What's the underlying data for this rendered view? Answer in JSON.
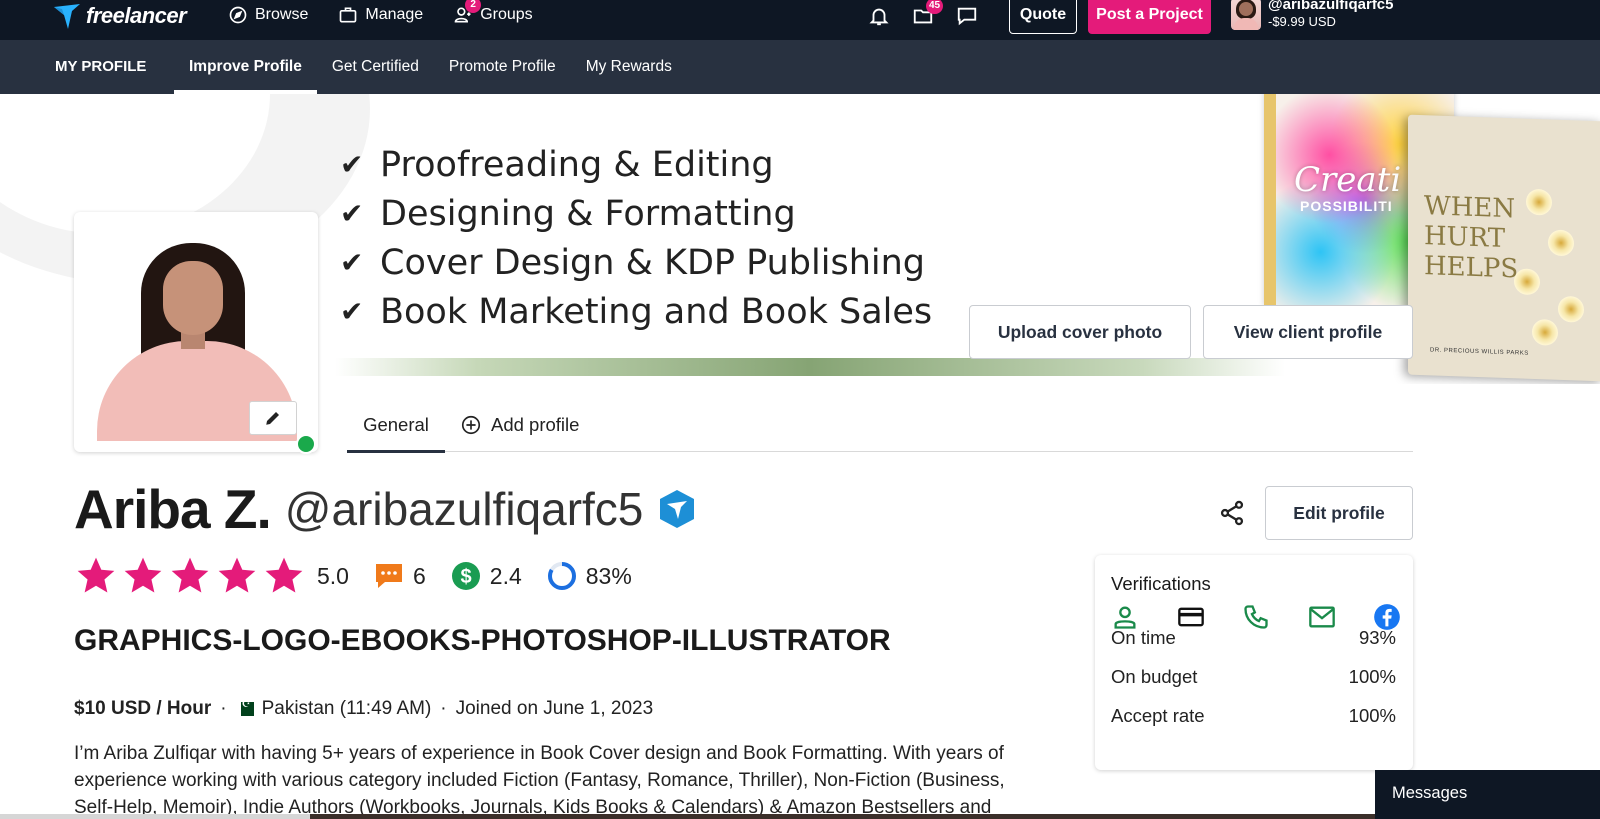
{
  "topbar": {
    "logo_text": "freelancer",
    "nav": [
      {
        "label": "Browse",
        "icon": "compass-icon"
      },
      {
        "label": "Manage",
        "icon": "briefcase-icon"
      },
      {
        "label": "Groups",
        "icon": "groups-icon",
        "badge": "2"
      }
    ],
    "projects_badge": "45",
    "quote_label": "Quote",
    "post_project_label": "Post a Project",
    "user_handle": "@aribazulfiqarfc5",
    "user_balance": "-$9.99 USD",
    "accent_color": "#e41b7a",
    "bg_color": "#0e1724"
  },
  "subnav": {
    "title": "MY PROFILE",
    "tabs": [
      "Improve Profile",
      "Get Certified",
      "Promote Profile",
      "My Rewards"
    ],
    "active_tab": "Improve Profile"
  },
  "cover": {
    "services": [
      "Proofreading & Editing",
      "Designing & Formatting",
      "Cover Design & KDP Publishing",
      "Book Marketing and Book Sales"
    ],
    "book1_title": "Creati",
    "book1_sub": "POSSIBILITI",
    "book2_title_lines": [
      "WHEN",
      "HURT",
      "HELPS"
    ],
    "book2_footer": "DR. PRECIOUS WILLIS PARKS",
    "upload_cover_label": "Upload cover photo",
    "view_client_label": "View client profile"
  },
  "profile_tabs": {
    "general": "General",
    "add_profile": "Add profile"
  },
  "profile": {
    "name": "Ariba Z.",
    "handle": "@aribazulfiqarfc5",
    "edit_label": "Edit profile",
    "rating": "5.0",
    "reviews": "6",
    "earnings_score": "2.4",
    "completion": "83%",
    "tagline": "GRAPHICS-LOGO-EBOOKS-PHOTOSHOP-ILLUSTRATOR",
    "rate": "$10 USD / Hour",
    "location": "Pakistan (11:49 AM)",
    "joined": "Joined on June 1, 2023",
    "bio": "I’m Ariba Zulfiqar with having 5+ years of experience in Book Cover design and Book Formatting. With years of experience working with various category included Fiction (Fantasy, Romance, Thriller), Non-Fiction (Business, Self-Help, Memoir), Indie Authors (Workbooks, Journals, Kids Books & Calendars) & Amazon Bestsellers and",
    "star_color": "#e41b7a",
    "online_color": "#1aa94b"
  },
  "verifications": {
    "title": "Verifications",
    "icons": [
      "user-icon",
      "card-icon",
      "phone-icon",
      "email-icon",
      "facebook-icon"
    ],
    "rows": [
      {
        "label": "On time",
        "value": "93%"
      },
      {
        "label": "On budget",
        "value": "100%"
      },
      {
        "label": "Accept rate",
        "value": "100%"
      }
    ]
  },
  "messages": {
    "label": "Messages"
  }
}
